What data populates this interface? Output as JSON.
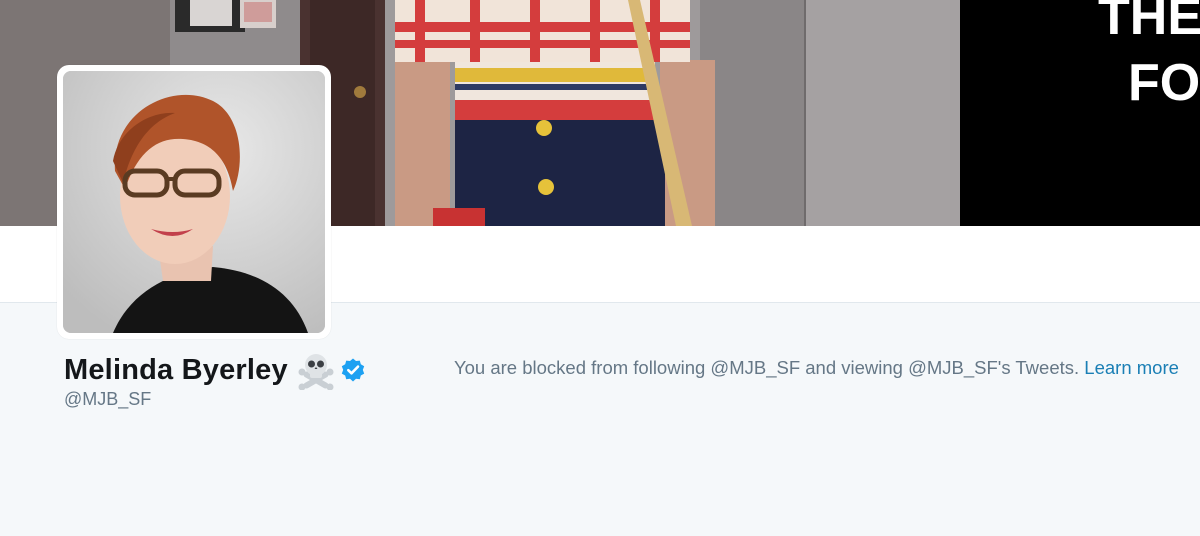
{
  "profile": {
    "name": "Melinda Byerley",
    "handle": "@MJB_SF",
    "name_emoji": "skull-and-crossbones-icon",
    "verified_icon": "verified-badge-icon"
  },
  "banner": {
    "overlay_text_line1": "THE",
    "overlay_text_line2": "FO"
  },
  "blocked_notice": {
    "message": "You are blocked from following @MJB_SF and viewing @MJB_SF's Tweets.",
    "link_label": "Learn more"
  },
  "colors": {
    "background": "#f5f8fa",
    "name_text": "#14171a",
    "muted_text": "#657786",
    "link": "#1a7fb5",
    "verified_blue": "#1da1f2"
  }
}
